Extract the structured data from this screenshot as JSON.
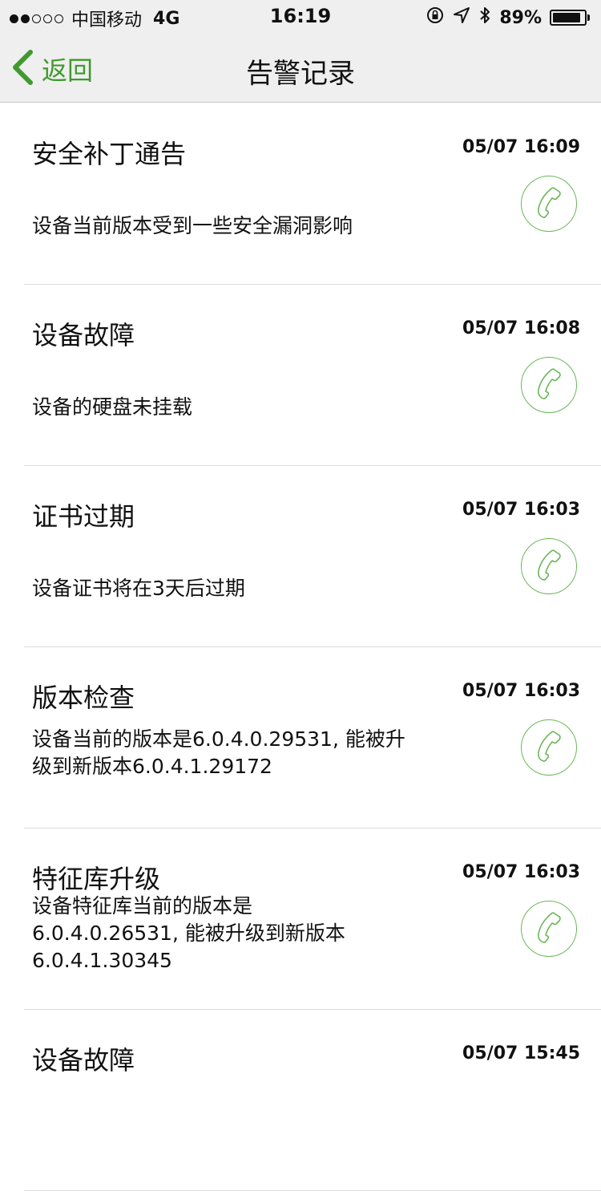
{
  "status_bar": {
    "carrier": "中国移动",
    "network": "4G",
    "time": "16:19",
    "battery_percent": "89%",
    "battery_level": 0.89,
    "signal_filled": 2,
    "signal_total": 5
  },
  "nav": {
    "back_label": "返回",
    "title": "告警记录"
  },
  "colors": {
    "accent_green": "#3f9a2e",
    "call_icon_green": "#6cb65a",
    "bar_background": "#efefef"
  },
  "alerts": [
    {
      "title": "安全补丁通告",
      "time": "05/07 16:09",
      "description": "设备当前版本受到一些安全漏洞影响"
    },
    {
      "title": "设备故障",
      "time": "05/07 16:08",
      "description": "设备的硬盘未挂载"
    },
    {
      "title": "证书过期",
      "time": "05/07 16:03",
      "description": "设备证书将在3天后过期"
    },
    {
      "title": "版本检查",
      "time": "05/07 16:03",
      "description": "设备当前的版本是6.0.4.0.29531, 能被升级到新版本6.0.4.1.29172"
    },
    {
      "title": "特征库升级",
      "time": "05/07 16:03",
      "description": "设备特征库当前的版本是 6.0.4.0.26531, 能被升级到新版本 6.0.4.1.30345"
    },
    {
      "title": "设备故障",
      "time": "05/07 15:45",
      "description": ""
    }
  ]
}
